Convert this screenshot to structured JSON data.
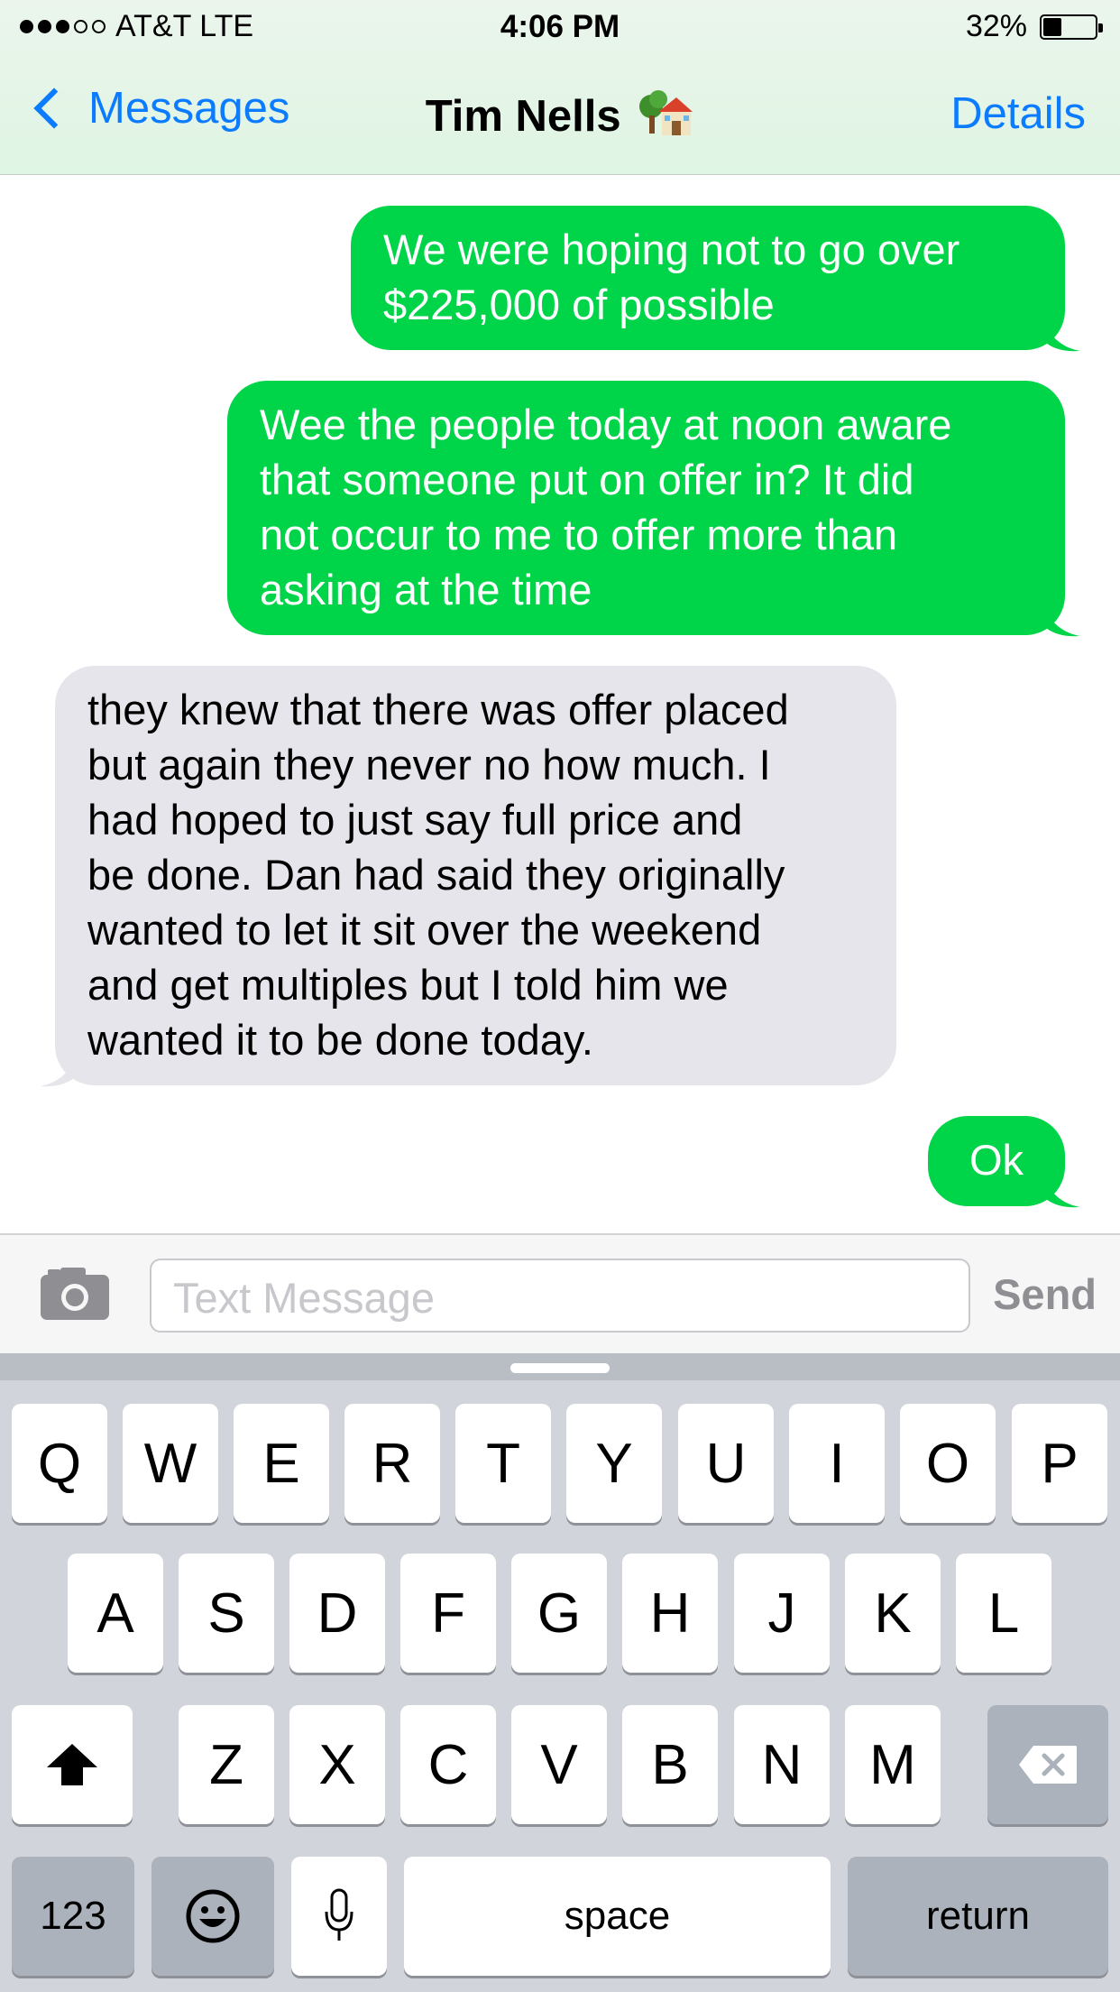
{
  "status_bar": {
    "carrier": "AT&T  LTE",
    "time": "4:06 PM",
    "battery": "32%",
    "battery_level": 0.32
  },
  "nav": {
    "back_label": "Messages",
    "contact_name": "Tim Nells",
    "contact_emoji": "house-with-tree-icon",
    "details_label": "Details"
  },
  "messages": [
    {
      "direction": "sent",
      "lines": [
        "We were hoping not to go over",
        "$225,000 of possible"
      ]
    },
    {
      "direction": "sent",
      "lines": [
        "Wee the people today at noon aware",
        "that someone put on offer in? It did",
        "not occur to me to offer more than",
        "asking at the time"
      ]
    },
    {
      "direction": "received",
      "lines": [
        "they knew that there was offer placed",
        "but again they never no how much. I",
        "had hoped to just say full price and",
        "be done. Dan had said they originally",
        "wanted to let it sit over the weekend",
        "and get multiples but I told him we",
        "wanted it to be done today."
      ]
    },
    {
      "direction": "sent",
      "lines": [
        "Ok"
      ]
    }
  ],
  "input": {
    "placeholder": "Text Message",
    "send_label": "Send",
    "camera_icon": "camera-icon"
  },
  "keyboard": {
    "row1": [
      "Q",
      "W",
      "E",
      "R",
      "T",
      "Y",
      "U",
      "I",
      "O",
      "P"
    ],
    "row2": [
      "A",
      "S",
      "D",
      "F",
      "G",
      "H",
      "J",
      "K",
      "L"
    ],
    "row3": [
      "Z",
      "X",
      "C",
      "V",
      "B",
      "N",
      "M"
    ],
    "numbers_label": "123",
    "space_label": "space",
    "return_label": "return",
    "shift_icon": "shift-icon",
    "delete_icon": "delete-icon",
    "emoji_icon": "emoji-icon",
    "mic_icon": "microphone-icon"
  },
  "colors": {
    "sent_bubble": "#00d449",
    "received_bubble": "#e6e5eb",
    "accent": "#0b7cff"
  }
}
